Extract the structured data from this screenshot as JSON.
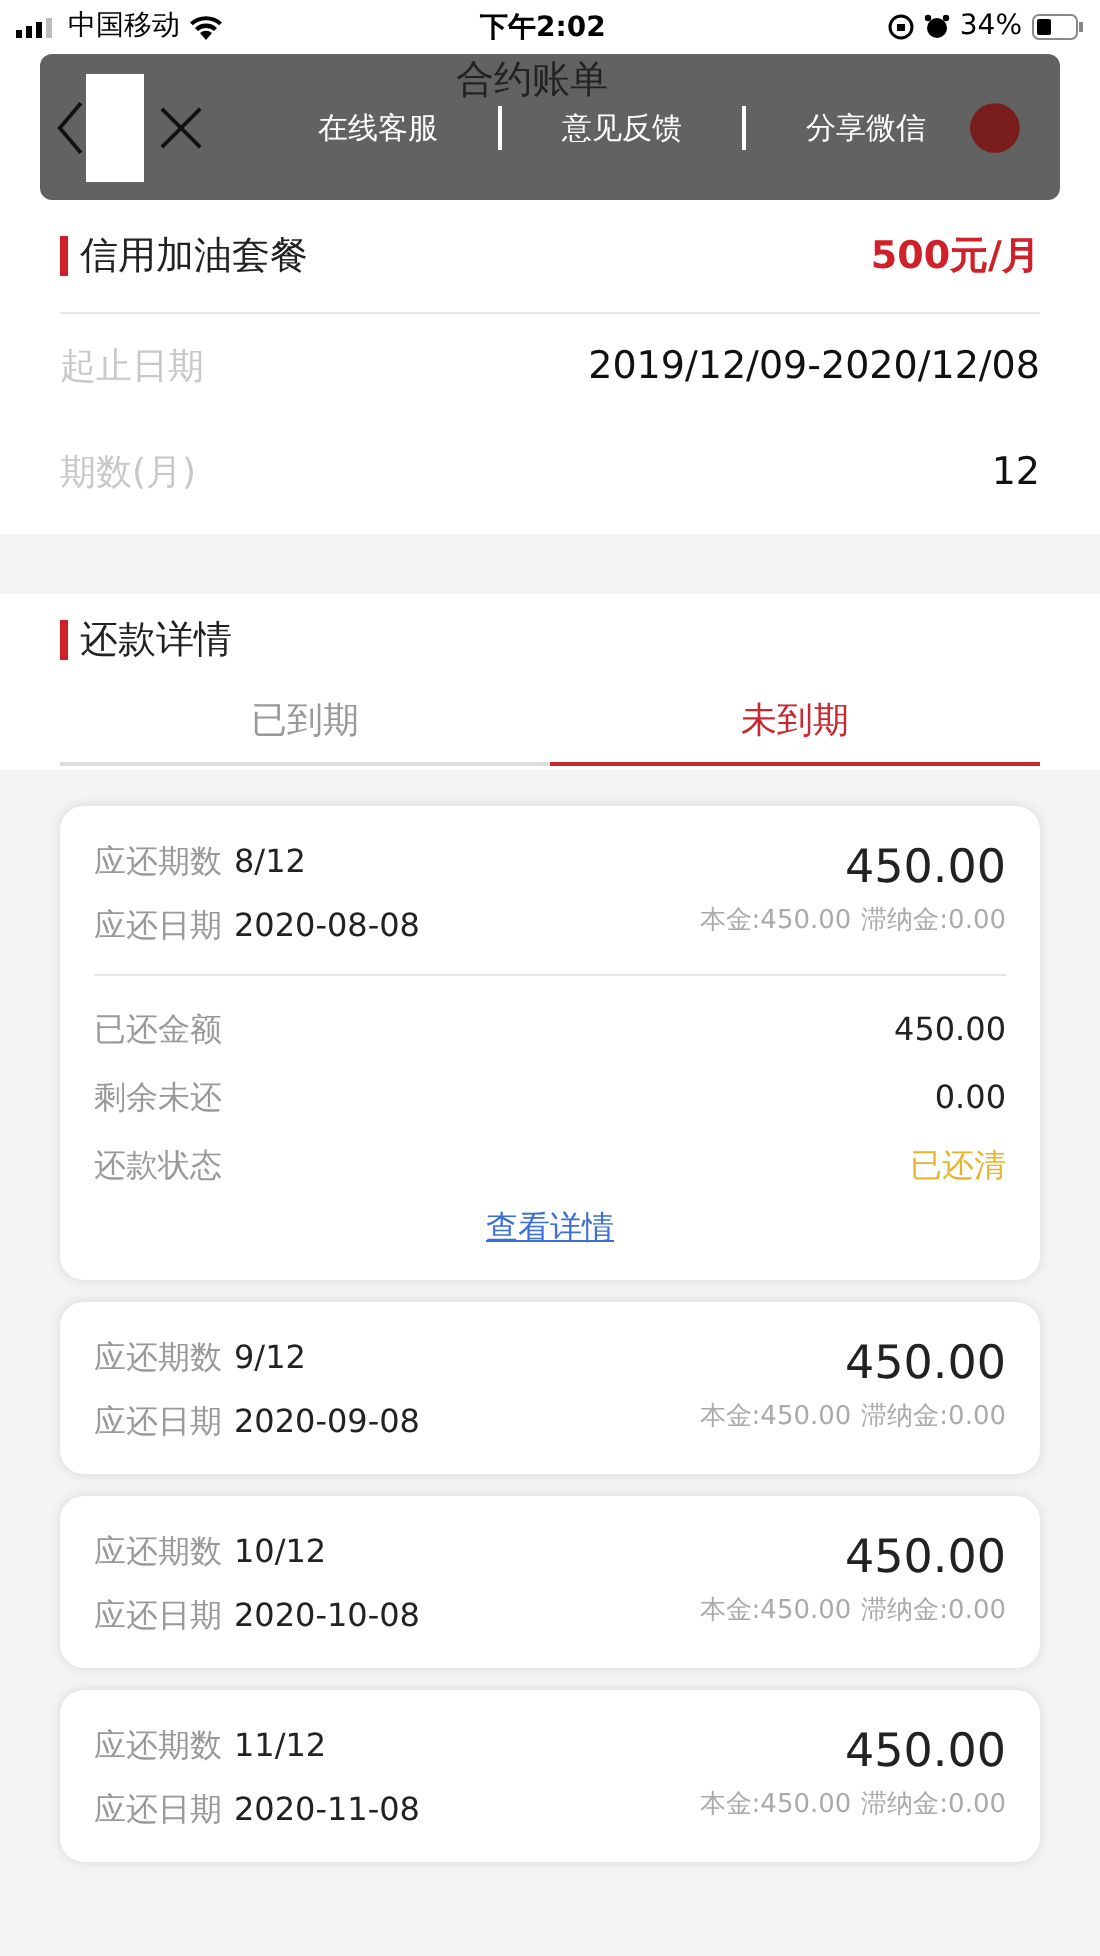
{
  "status_bar": {
    "carrier": "中国移动",
    "time": "下午2:02",
    "battery": "34%"
  },
  "header": {
    "title": "合约账单"
  },
  "overlay_menu": {
    "items": [
      "在线客服",
      "意见反馈",
      "分享微信"
    ]
  },
  "plan": {
    "name": "信用加油套餐",
    "price": "500元/月",
    "rows": [
      {
        "label": "起止日期",
        "value": "2019/12/09-2020/12/08"
      },
      {
        "label": "期数(月)",
        "value": "12"
      }
    ]
  },
  "repayment": {
    "title": "还款详情",
    "tabs": [
      {
        "label": "已到期",
        "selected": false
      },
      {
        "label": "未到期",
        "selected": true
      }
    ],
    "bills": [
      {
        "period_label": "应还期数",
        "period": "8/12",
        "date_label": "应还日期",
        "date": "2020-08-08",
        "amount": "450.00",
        "principal": "本金:450.00",
        "late_fee": "滞纳金:0.00",
        "details": [
          {
            "label": "已还金额",
            "value": "450.00",
            "kind": "plain"
          },
          {
            "label": "剩余未还",
            "value": "0.00",
            "kind": "plain"
          },
          {
            "label": "还款状态",
            "value": "已还清",
            "kind": "status"
          }
        ],
        "link": "查看详情"
      },
      {
        "period_label": "应还期数",
        "period": "9/12",
        "date_label": "应还日期",
        "date": "2020-09-08",
        "amount": "450.00",
        "principal": "本金:450.00",
        "late_fee": "滞纳金:0.00"
      },
      {
        "period_label": "应还期数",
        "period": "10/12",
        "date_label": "应还日期",
        "date": "2020-10-08",
        "amount": "450.00",
        "principal": "本金:450.00",
        "late_fee": "滞纳金:0.00"
      },
      {
        "period_label": "应还期数",
        "period": "11/12",
        "date_label": "应还日期",
        "date": "2020-11-08",
        "amount": "450.00",
        "principal": "本金:450.00",
        "late_fee": "滞纳金:0.00"
      }
    ]
  }
}
